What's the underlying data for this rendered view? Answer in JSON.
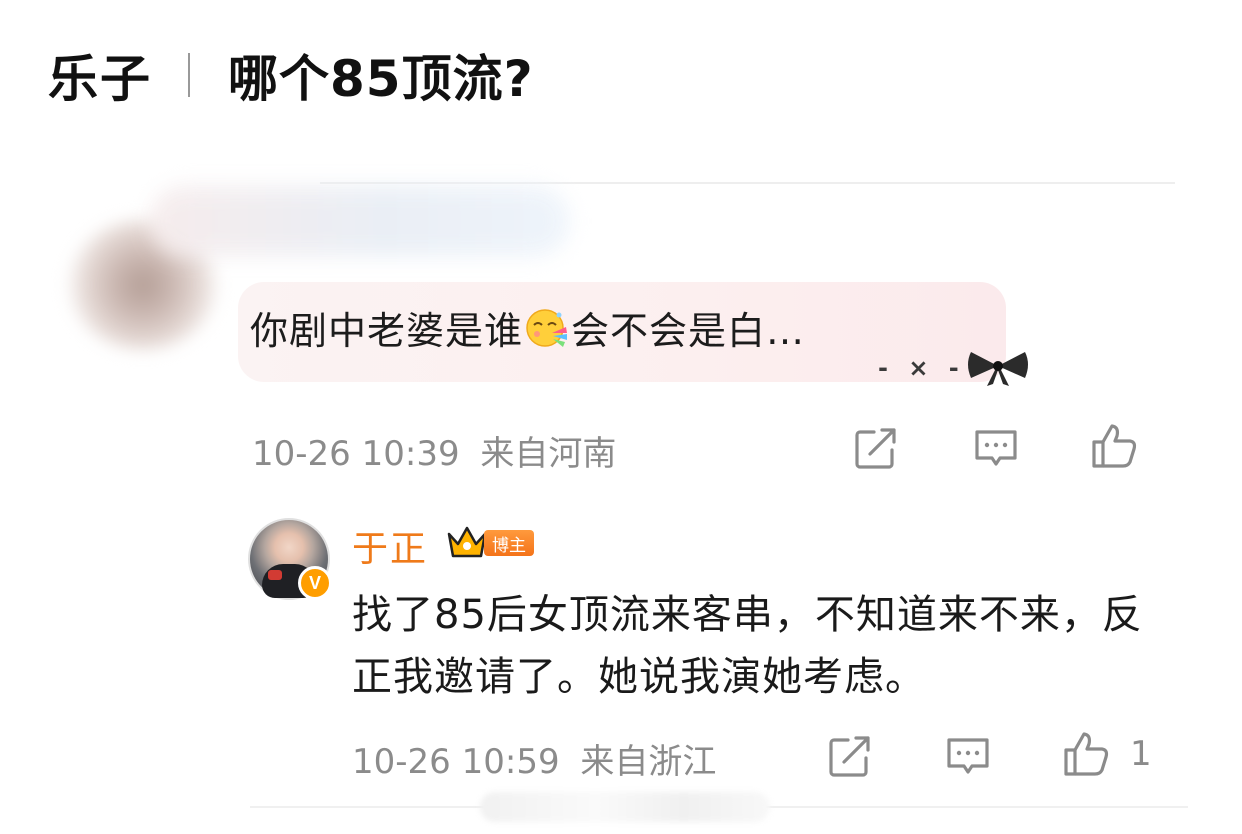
{
  "header": {
    "tag": "乐子",
    "title": "哪个85顶流?"
  },
  "comment": {
    "text_before_emoji": "你剧中老婆是谁",
    "emoji": "face-emoji",
    "text_after_emoji": "会不会是白…",
    "decoration": "- × -",
    "time": "10-26 10:39",
    "location": "来自河南"
  },
  "reply": {
    "username": "于正",
    "badge": "博主",
    "text": "找了85后女顶流来客串，不知道来不来，反正我邀请了。她说我演她考虑。",
    "time": "10-26 10:59",
    "location": "来自浙江",
    "likes": "1",
    "verified_mark": "V"
  },
  "icons": {
    "share": "share-icon",
    "comment": "comment-icon",
    "like": "thumbs-up-icon",
    "crown": "crown-icon",
    "bow": "bow-icon"
  },
  "colors": {
    "username": "#ef7a1a",
    "badge": "#f47319",
    "meta": "#8b8b8b",
    "bubble": "#fcefef"
  }
}
